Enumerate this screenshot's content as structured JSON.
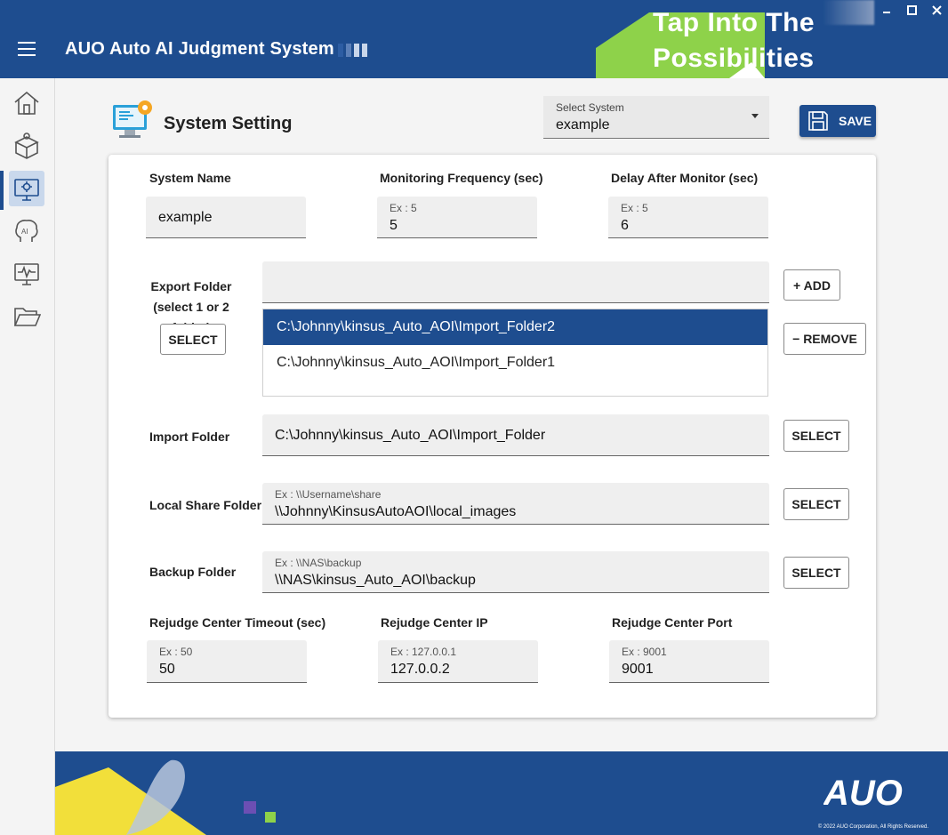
{
  "header": {
    "app_title": "AUO Auto AI Judgment System",
    "banner_line1": "Tap Into The",
    "banner_line2": "Possibilities"
  },
  "window_controls": [
    "minimize",
    "maximize",
    "close"
  ],
  "sidebar": {
    "items": [
      {
        "icon": "home-icon"
      },
      {
        "icon": "package-icon"
      },
      {
        "icon": "settings-monitor-icon",
        "active": true
      },
      {
        "icon": "ai-brain-icon"
      },
      {
        "icon": "monitor-pulse-icon"
      },
      {
        "icon": "folder-open-icon"
      }
    ]
  },
  "page": {
    "title": "System Setting",
    "select_system": {
      "label": "Select System",
      "value": "example"
    },
    "save_label": "SAVE"
  },
  "form": {
    "system_name": {
      "label": "System Name",
      "value": "example"
    },
    "monitoring_frequency": {
      "label": "Monitoring Frequency (sec)",
      "placeholder": "Ex : 5",
      "value": "5"
    },
    "delay_after_monitor": {
      "label": "Delay After Monitor (sec)",
      "placeholder": "Ex : 5",
      "value": "6"
    },
    "export_folder": {
      "label_line1": "Export Folder",
      "label_line2": "(select 1 or 2 folder)",
      "select_label": "SELECT",
      "add_label": "+ ADD",
      "remove_label": "− REMOVE",
      "input_value": "",
      "items": [
        {
          "path": "C:\\Johnny\\kinsus_Auto_AOI\\Import_Folder2",
          "selected": true
        },
        {
          "path": "C:\\Johnny\\kinsus_Auto_AOI\\Import_Folder1",
          "selected": false
        }
      ]
    },
    "import_folder": {
      "label": "Import Folder",
      "value": "C:\\Johnny\\kinsus_Auto_AOI\\Import_Folder",
      "select_label": "SELECT"
    },
    "local_share_folder": {
      "label": "Local Share Folder",
      "placeholder": "Ex : \\\\Username\\share",
      "value": "\\\\Johnny\\KinsusAutoAOI\\local_images",
      "select_label": "SELECT"
    },
    "backup_folder": {
      "label": "Backup Folder",
      "placeholder": "Ex : \\\\NAS\\backup",
      "value": "\\\\NAS\\kinsus_Auto_AOI\\backup",
      "select_label": "SELECT"
    },
    "rejudge_timeout": {
      "label": "Rejudge Center Timeout (sec)",
      "placeholder": "Ex : 50",
      "value": "50"
    },
    "rejudge_ip": {
      "label": "Rejudge Center IP",
      "placeholder": "Ex : 127.0.0.1",
      "value": "127.0.0.2"
    },
    "rejudge_port": {
      "label": "Rejudge Center Port",
      "placeholder": "Ex : 9001",
      "value": "9001"
    }
  },
  "footer": {
    "logo_text": "AUO",
    "copyright": "© 2022 AUO Corporation, All Rights Reserved."
  },
  "colors": {
    "primary": "#1e4d8f",
    "banner_green": "#8ed24a",
    "footer_yellow": "#f2df3a"
  }
}
